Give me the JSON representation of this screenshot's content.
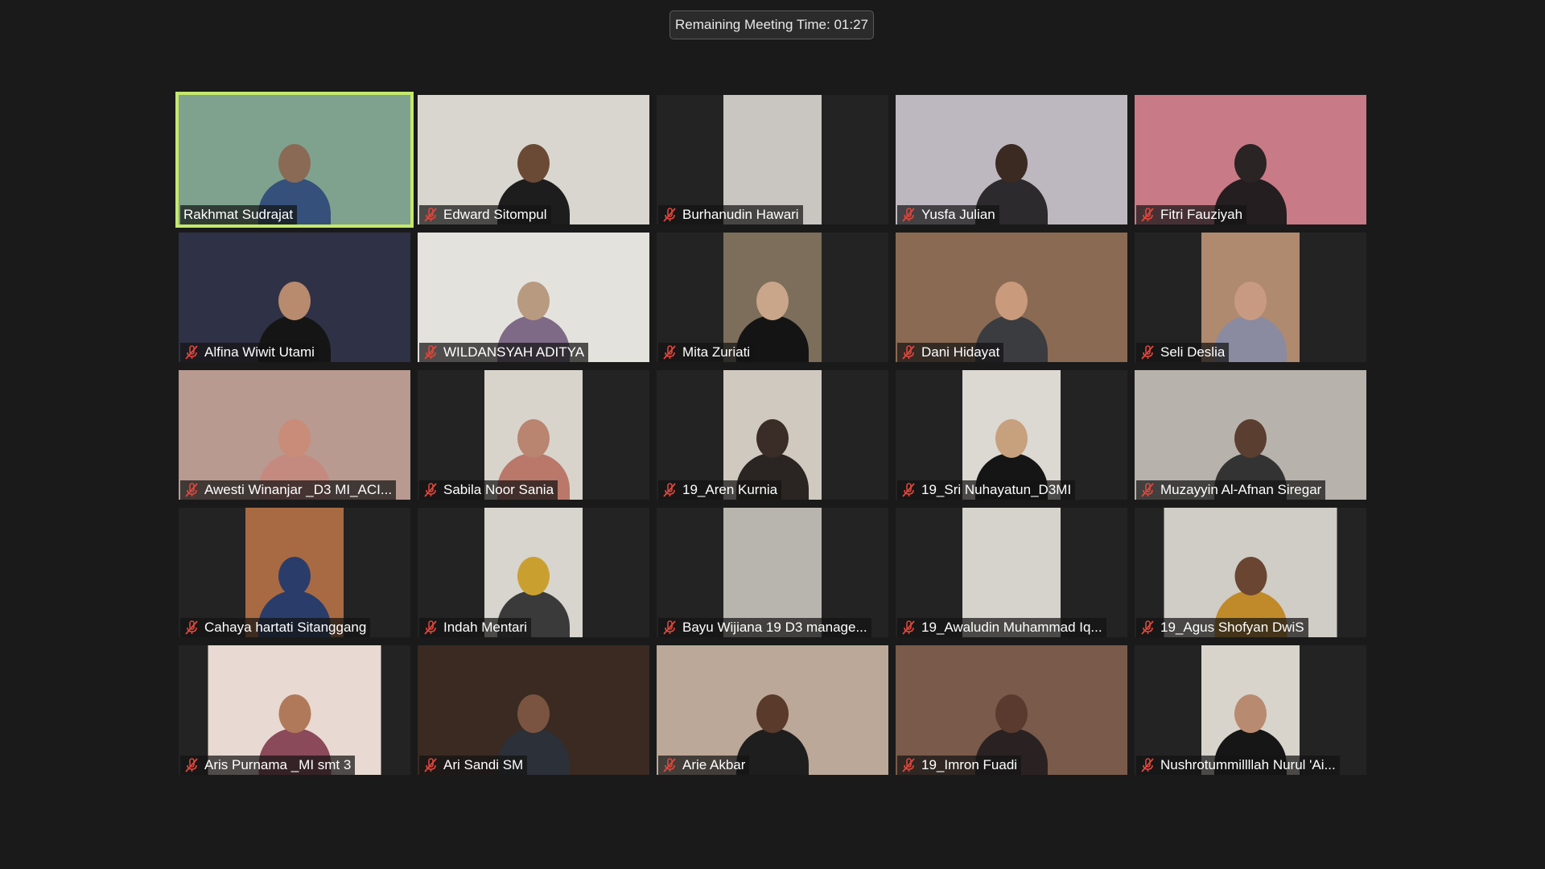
{
  "meeting": {
    "remaining_time_text": "Remaining Meeting Time: 01:27"
  },
  "colors": {
    "background": "#1a1a1a",
    "tile": "#232323",
    "active_speaker_border": "#c5e86c",
    "mute_icon": "#e0463c",
    "label_text": "#ffffff"
  },
  "participants": [
    {
      "name": "Rakhmat Sudrajat",
      "muted": false,
      "active": true,
      "video": "full",
      "bg": "#7fa28e",
      "head": "#8a6a55",
      "body": "#35507a"
    },
    {
      "name": "Edward Sitompul",
      "muted": true,
      "active": false,
      "video": "full",
      "bg": "#d9d6cf",
      "head": "#6b4a35",
      "body": "#1d1d1d"
    },
    {
      "name": "Burhanudin Hawari",
      "muted": true,
      "active": false,
      "video": "mid",
      "bg": "#c9c6c2",
      "head": "",
      "body": ""
    },
    {
      "name": "Yusfa Julian",
      "muted": true,
      "active": false,
      "video": "full",
      "bg": "#bdb8c0",
      "head": "#3a2a22",
      "body": "#2c2a2c"
    },
    {
      "name": "Fitri Fauziyah",
      "muted": true,
      "active": false,
      "video": "full",
      "bg": "#c87a86",
      "head": "#2a2424",
      "body": "#241e20"
    },
    {
      "name": "Alfina Wiwit Utami",
      "muted": true,
      "active": false,
      "video": "full",
      "bg": "#2f3146",
      "head": "#b88a6e",
      "body": "#151515"
    },
    {
      "name": "WILDANSYAH ADITYA",
      "muted": true,
      "active": false,
      "video": "full",
      "bg": "#e4e2dd",
      "head": "#b89a80",
      "body": "#7e6a86"
    },
    {
      "name": "Mita Zuriati",
      "muted": true,
      "active": false,
      "video": "mid",
      "bg": "#7c6e5a",
      "head": "#c9a58a",
      "body": "#141414"
    },
    {
      "name": "Dani Hidayat",
      "muted": true,
      "active": false,
      "video": "full",
      "bg": "#8a6a52",
      "head": "#c99a7c",
      "body": "#3a3c40"
    },
    {
      "name": "Seli Deslia",
      "muted": true,
      "active": false,
      "video": "mid",
      "bg": "#b08a6e",
      "head": "#c99a82",
      "body": "#8a8aa0"
    },
    {
      "name": "Awesti Winanjar _D3 MI_ACI...",
      "muted": true,
      "active": false,
      "video": "full",
      "bg": "#b89a90",
      "head": "#c88c78",
      "body": "#c48a80"
    },
    {
      "name": "Sabila Noor Sania",
      "muted": true,
      "active": false,
      "video": "mid",
      "bg": "#d8d4cc",
      "head": "#b98470",
      "body": "#b9786a"
    },
    {
      "name": "19_Aren Kurnia",
      "muted": true,
      "active": false,
      "video": "mid",
      "bg": "#cfc9c0",
      "head": "#3a2c26",
      "body": "#2a2422"
    },
    {
      "name": "19_Sri Nuhayatun_D3MI",
      "muted": true,
      "active": false,
      "video": "mid",
      "bg": "#dcd8d2",
      "head": "#c7a07e",
      "body": "#151515"
    },
    {
      "name": "Muzayyin Al-Afnan Siregar",
      "muted": true,
      "active": false,
      "video": "full",
      "bg": "#b8b2ac",
      "head": "#5a3e30",
      "body": "#333333"
    },
    {
      "name": "Cahaya hartati Sitanggang",
      "muted": true,
      "active": false,
      "video": "mid",
      "bg": "#a86a42",
      "head": "#2a3c6a",
      "body": "#2a3c6a"
    },
    {
      "name": "Indah Mentari",
      "muted": true,
      "active": false,
      "video": "mid",
      "bg": "#d8d4ce",
      "head": "#c9a030",
      "body": "#3a3a3a"
    },
    {
      "name": "Bayu Wijiana 19 D3 manage...",
      "muted": true,
      "active": false,
      "video": "mid",
      "bg": "#b8b4ae",
      "head": "",
      "body": ""
    },
    {
      "name": "19_Awaludin Muhammad Iq...",
      "muted": true,
      "active": false,
      "video": "mid",
      "bg": "#d6d2cc",
      "head": "",
      "body": ""
    },
    {
      "name": "19_Agus Shofyan DwiS",
      "muted": true,
      "active": false,
      "video": "mid",
      "bg": "#d0ccc6",
      "head": "#6a4632",
      "body": "#c08a2a"
    },
    {
      "name": "Aris Purnama _MI smt 3",
      "muted": true,
      "active": false,
      "video": "mid",
      "bg": "#e8dad2",
      "head": "#b07a5a",
      "body": "#8a4a5a"
    },
    {
      "name": "Ari Sandi SM",
      "muted": true,
      "active": false,
      "video": "full",
      "bg": "#3a2a22",
      "head": "#7a5440",
      "body": "#2c3038"
    },
    {
      "name": "Arie Akbar",
      "muted": true,
      "active": false,
      "video": "full",
      "bg": "#bca898",
      "head": "#5a3a2a",
      "body": "#1e1e1e"
    },
    {
      "name": "19_Imron Fuadi",
      "muted": true,
      "active": false,
      "video": "full",
      "bg": "#7a5a4a",
      "head": "#5a3a2e",
      "body": "#2a2222"
    },
    {
      "name": "Nushrotummillllah Nurul 'Ai...",
      "muted": true,
      "active": false,
      "video": "mid",
      "bg": "#d8d4cc",
      "head": "#b88a70",
      "body": "#161616"
    }
  ]
}
